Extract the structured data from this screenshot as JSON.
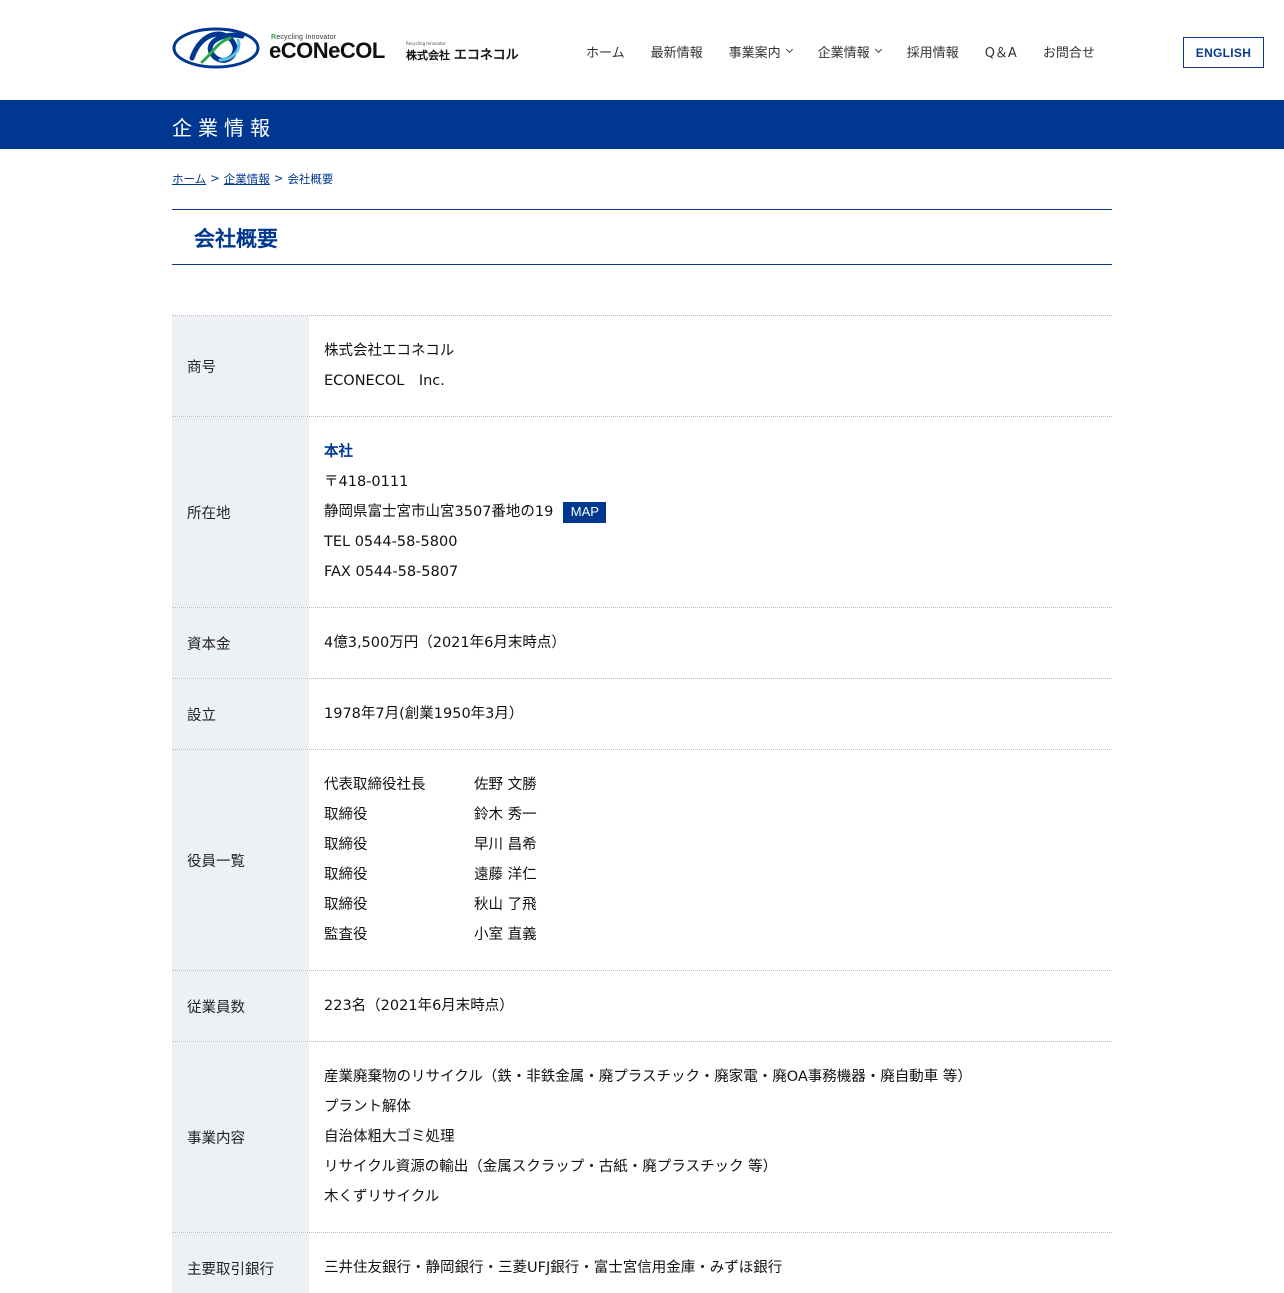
{
  "header": {
    "logo": {
      "tagline_r": "R",
      "tagline_rest": "ecycling Innovator",
      "wordmark": "eCONeCOL",
      "jp_mini": "Recycling Innovator",
      "jp_company": "株式会社",
      "jp_name": "エコネコル"
    },
    "nav": [
      {
        "label": "ホーム",
        "dropdown": false
      },
      {
        "label": "最新情報",
        "dropdown": false
      },
      {
        "label": "事業案内",
        "dropdown": true
      },
      {
        "label": "企業情報",
        "dropdown": true
      },
      {
        "label": "採用情報",
        "dropdown": false
      },
      {
        "label": "Q＆A",
        "dropdown": false
      },
      {
        "label": "お問合せ",
        "dropdown": false
      }
    ],
    "english_label": "ENGLISH"
  },
  "band": {
    "title": "企業情報"
  },
  "breadcrumb": {
    "home": "ホーム",
    "sep": ">",
    "section": "企業情報",
    "current": "会社概要"
  },
  "page_title": "会社概要",
  "colors": {
    "brand": "#003891",
    "header_cell_bg": "#edf1f5"
  },
  "table": {
    "trade_name": {
      "label": "商号",
      "lines": [
        "株式会社エコネコル",
        "ECONECOL　Inc."
      ]
    },
    "location": {
      "label": "所在地",
      "office": "本社",
      "postal": "〒418-0111",
      "address": "静岡県富士宮市山宮3507番地の19",
      "map_label": "MAP",
      "tel": "TEL 0544-58-5800",
      "fax": "FAX 0544-58-5807"
    },
    "capital": {
      "label": "資本金",
      "value": "4億3,500万円（2021年6月末時点）"
    },
    "established": {
      "label": "設立",
      "value": "1978年7月(創業1950年3月）"
    },
    "officers": {
      "label": "役員一覧",
      "list": [
        {
          "role": "代表取締役社長",
          "name": "佐野 文勝"
        },
        {
          "role": "取締役",
          "name": "鈴木 秀一"
        },
        {
          "role": "取締役",
          "name": "早川 昌希"
        },
        {
          "role": "取締役",
          "name": "遠藤 洋仁"
        },
        {
          "role": "取締役",
          "name": "秋山 了飛"
        },
        {
          "role": "監査役",
          "name": "小室 直義"
        }
      ]
    },
    "employees": {
      "label": "従業員数",
      "value": "223名（2021年6月末時点）"
    },
    "business": {
      "label": "事業内容",
      "lines": [
        "産業廃棄物のリサイクル（鉄・非鉄金属・廃プラスチック・廃家電・廃OA事務機器・廃自動車 等）",
        "プラント解体",
        "自治体粗大ゴミ処理",
        "リサイクル資源の輸出（金属スクラップ・古紙・廃プラスチック 等）",
        "木くずリサイクル"
      ]
    },
    "banks": {
      "label": "主要取引銀行",
      "value": "三井住友銀行・静岡銀行・三菱UFJ銀行・富士宮信用金庫・みずほ銀行"
    }
  }
}
